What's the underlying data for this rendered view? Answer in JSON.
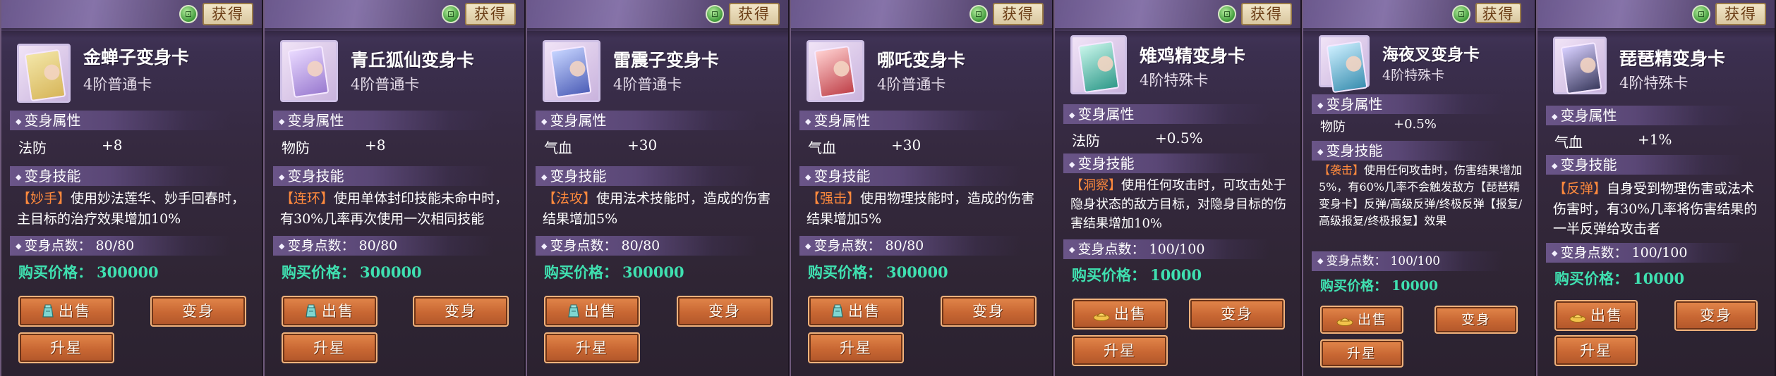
{
  "ui": {
    "get_label": "获得",
    "attr_section": "变身属性",
    "skill_section": "变身技能",
    "points_label": "变身点数：",
    "price_label": "购买价格：",
    "sell_label": "出售",
    "transform_label": "变身",
    "upgrade_label": "升星"
  },
  "cards": [
    {
      "name": "金蝉子变身卡",
      "grade": "4阶普通卡",
      "attr_name": "法防",
      "attr_value": "+8",
      "skill_tag": "【妙手】",
      "skill_text": "使用妙法莲华、妙手回春时，主目标的治疗效果增加10%",
      "points": "80/80",
      "price": "300000",
      "sell_icon": "teal-bag-icon",
      "colors": {
        "art": "#d7b65a",
        "accent": "#f3e6a8"
      }
    },
    {
      "name": "青丘狐仙变身卡",
      "grade": "4阶普通卡",
      "attr_name": "物防",
      "attr_value": "+8",
      "skill_tag": "【连环】",
      "skill_text": "使用单体封印技能未命中时，有30%几率再次使用一次相同技能",
      "points": "80/80",
      "price": "300000",
      "sell_icon": "teal-bag-icon",
      "colors": {
        "art": "#9a7bd0",
        "accent": "#e9d9ff"
      }
    },
    {
      "name": "雷震子变身卡",
      "grade": "4阶普通卡",
      "attr_name": "气血",
      "attr_value": "+30",
      "skill_tag": "【法攻】",
      "skill_text": "使用法术技能时，造成的伤害结果增加5%",
      "points": "80/80",
      "price": "300000",
      "sell_icon": "teal-bag-icon",
      "colors": {
        "art": "#4e5fb8",
        "accent": "#c6d4ff"
      }
    },
    {
      "name": "哪吒变身卡",
      "grade": "4阶普通卡",
      "attr_name": "气血",
      "attr_value": "+30",
      "skill_tag": "【强击】",
      "skill_text": "使用物理技能时，造成的伤害结果增加5%",
      "points": "80/80",
      "price": "300000",
      "sell_icon": "teal-bag-icon",
      "colors": {
        "art": "#c0424a",
        "accent": "#ffd0d0"
      }
    },
    {
      "name": "雉鸡精变身卡",
      "grade": "4阶特殊卡",
      "attr_name": "法防",
      "attr_value": "+0.5%",
      "skill_tag": "【洞察】",
      "skill_text": "使用任何攻击时，可攻击处于隐身状态的敌方目标，对隐身目标的伤害结果增加10%",
      "points": "100/100",
      "price": "10000",
      "sell_icon": "gold-ingot-icon",
      "colors": {
        "art": "#2f9a8a",
        "accent": "#c8f5ea"
      }
    },
    {
      "name": "海夜叉变身卡",
      "grade": "4阶特殊卡",
      "attr_name": "物防",
      "attr_value": "+0.5%",
      "skill_tag": "【袭击】",
      "skill_text": "使用任何攻击时，伤害结果增加5%，有60%几率不会触发敌方【琵琶精变身卡】反弹/高级反弹/终极反弹【报复/高级报复/终极报复】效果",
      "points": "100/100",
      "price": "10000",
      "sell_icon": "gold-ingot-icon",
      "colors": {
        "art": "#3a8fb0",
        "accent": "#cdefff"
      }
    },
    {
      "name": "琵琶精变身卡",
      "grade": "4阶特殊卡",
      "attr_name": "气血",
      "attr_value": "+1%",
      "skill_tag": "【反弹】",
      "skill_text": "自身受到物理伤害或法术伤害时，有30%几率将伤害结果的一半反弹给攻击者",
      "points": "100/100",
      "price": "10000",
      "sell_icon": "gold-ingot-icon",
      "colors": {
        "art": "#3a3a5e",
        "accent": "#d8d0ff"
      }
    }
  ]
}
